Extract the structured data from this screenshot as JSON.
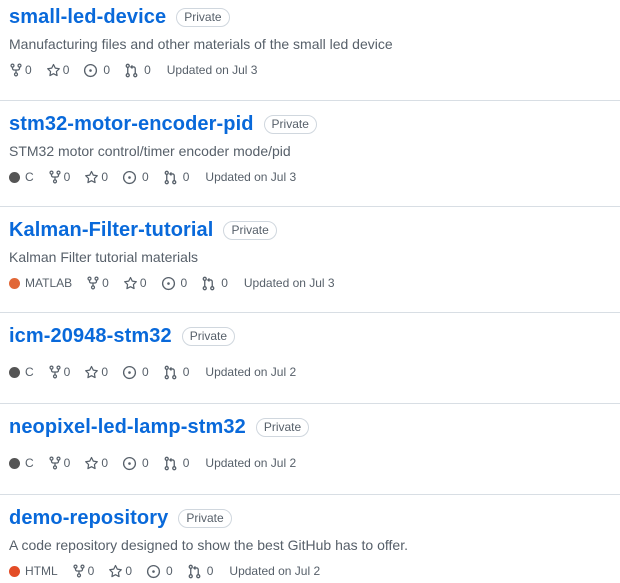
{
  "repos": [
    {
      "name": "small-led-device",
      "visibility": "Private",
      "description": "Manufacturing files and other materials of the small led device",
      "language": "",
      "language_color": "",
      "forks": "0",
      "stars": "0",
      "issues": "0",
      "pulls": "0",
      "updated": "Updated on Jul 3"
    },
    {
      "name": "stm32-motor-encoder-pid",
      "visibility": "Private",
      "description": "STM32 motor control/timer encoder mode/pid",
      "language": "C",
      "language_color": "#555555",
      "forks": "0",
      "stars": "0",
      "issues": "0",
      "pulls": "0",
      "updated": "Updated on Jul 3"
    },
    {
      "name": "Kalman-Filter-tutorial",
      "visibility": "Private",
      "description": "Kalman Filter tutorial materials",
      "language": "MATLAB",
      "language_color": "#e16737",
      "forks": "0",
      "stars": "0",
      "issues": "0",
      "pulls": "0",
      "updated": "Updated on Jul 3"
    },
    {
      "name": "icm-20948-stm32",
      "visibility": "Private",
      "description": "",
      "language": "C",
      "language_color": "#555555",
      "forks": "0",
      "stars": "0",
      "issues": "0",
      "pulls": "0",
      "updated": "Updated on Jul 2"
    },
    {
      "name": "neopixel-led-lamp-stm32",
      "visibility": "Private",
      "description": "",
      "language": "C",
      "language_color": "#555555",
      "forks": "0",
      "stars": "0",
      "issues": "0",
      "pulls": "0",
      "updated": "Updated on Jul 2"
    },
    {
      "name": "demo-repository",
      "visibility": "Private",
      "description": "A code repository designed to show the best GitHub has to offer.",
      "language": "HTML",
      "language_color": "#e34c26",
      "forks": "0",
      "stars": "0",
      "issues": "0",
      "pulls": "0",
      "updated": "Updated on Jul 2"
    }
  ],
  "icons": {
    "fork": "repo-forked-icon",
    "star": "star-icon",
    "issue": "issue-opened-icon",
    "pull": "git-pull-request-icon"
  },
  "colors": {
    "link": "#0969da",
    "muted": "#57606a",
    "border": "#d0d7de"
  }
}
